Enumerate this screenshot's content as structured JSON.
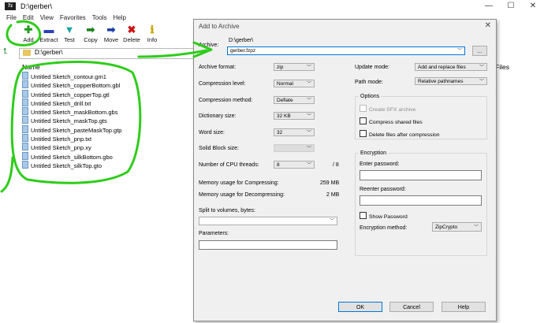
{
  "window": {
    "title": "D:\\gerber\\",
    "controls": [
      "—",
      "☐",
      "✕"
    ]
  },
  "menu": [
    "File",
    "Edit",
    "View",
    "Favorites",
    "Tools",
    "Help"
  ],
  "toolbar": [
    {
      "label": "Add",
      "icon": "✚",
      "color": "#1e9b1e"
    },
    {
      "label": "Extract",
      "icon": "▬",
      "color": "#2a3fb8"
    },
    {
      "label": "Test",
      "icon": "▼",
      "color": "#1aa6a6"
    },
    {
      "label": "Copy",
      "icon": "➡",
      "color": "#1e7f1e"
    },
    {
      "label": "Move",
      "icon": "➡",
      "color": "#1d3fa8"
    },
    {
      "label": "Delete",
      "icon": "✖",
      "color": "#cc1111"
    },
    {
      "label": "Info",
      "icon": "ℹ",
      "color": "#c9a400"
    }
  ],
  "address": "D:\\gerber\\",
  "columns": {
    "name": "Name",
    "files": "Files"
  },
  "files": [
    "Untitled Sketch_contour.gm1",
    "Untitled Sketch_copperBottom.gbl",
    "Untitled Sketch_copperTop.gtl",
    "Untitled Sketch_drill.txt",
    "Untitled Sketch_maskBottom.gbs",
    "Untitled Sketch_maskTop.gts",
    "Untitled Sketch_pasteMaskTop.gtp",
    "Untitled Sketch_pnp.txt",
    "Untitled Sketch_pnp.xy",
    "Untitled Sketch_silkBottom.gbo",
    "Untitled Sketch_silkTop.gto"
  ],
  "dialog": {
    "title": "Add to Archive",
    "archive_label": "Archive:",
    "archive_path": "D:\\gerber\\",
    "archive_name": "gerber.fzpz",
    "browse": "...",
    "format_label": "Archive format:",
    "format": "zip",
    "level_label": "Compression level:",
    "level": "Normal",
    "method_label": "Compression method:",
    "method": "Deflate",
    "dict_label": "Dictionary size:",
    "dict": "32 KB",
    "word_label": "Word size:",
    "word": "32",
    "solid_label": "Solid Block size:",
    "threads_label": "Number of CPU threads:",
    "threads": "8",
    "threads_max": "/ 8",
    "mem_comp_label": "Memory usage for Compressing:",
    "mem_comp": "259 MB",
    "mem_decomp_label": "Memory usage for Decompressing:",
    "mem_decomp": "2 MB",
    "split_label": "Split to volumes, bytes:",
    "params_label": "Parameters:",
    "update_label": "Update mode:",
    "update": "Add and replace files",
    "path_label": "Path mode:",
    "path": "Relative pathnames",
    "options_label": "Options",
    "opt_sfx": "Create SFX archive",
    "opt_shared": "Compress shared files",
    "opt_delete": "Delete files after compression",
    "enc_label": "Encryption",
    "enter_pw": "Enter password:",
    "reenter_pw": "Reenter password:",
    "show_pw": "Show Password",
    "enc_method_label": "Encryption method:",
    "enc_method": "ZipCrypto",
    "ok": "OK",
    "cancel": "Cancel",
    "help": "Help"
  },
  "colors": {
    "annotation": "#2ecc1a",
    "accent": "#0078d7"
  }
}
